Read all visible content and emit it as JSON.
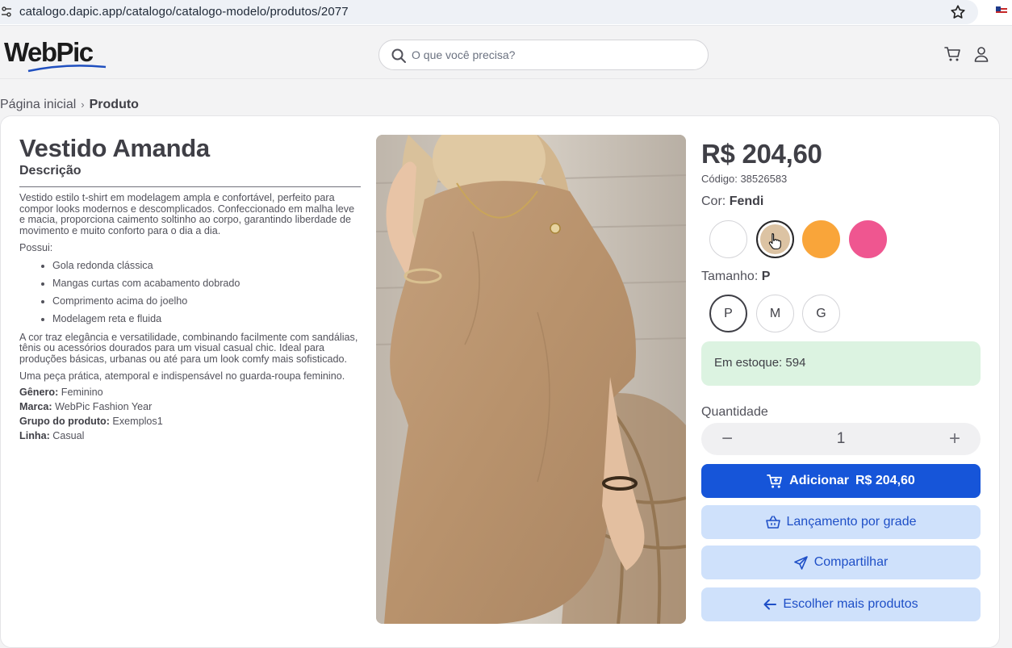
{
  "browser": {
    "url": "catalogo.dapic.app/catalogo/catalogo-modelo/produtos/2077"
  },
  "header": {
    "logo_text": "WebPic",
    "search_placeholder": "O que você precisa?",
    "icons": [
      "search-icon",
      "cart-icon",
      "user-icon"
    ]
  },
  "breadcrumb": {
    "home": "Página inicial",
    "separator": "›",
    "current": "Produto"
  },
  "product": {
    "title": "Vestido Amanda",
    "description_heading": "Descrição",
    "intro": "Vestido estilo t-shirt em modelagem ampla e confortável, perfeito para compor looks modernos e descomplicados. Confeccionado em malha leve e macia, proporciona caimento soltinho ao corpo, garantindo liberdade de movimento e muito conforto para o dia a dia.",
    "features_heading": "Possui:",
    "features": [
      "Gola redonda clássica",
      "Mangas curtas com acabamento dobrado",
      "Comprimento acima do joelho",
      "Modelagem reta e fluida"
    ],
    "styling": "A cor  traz elegância e versatilidade, combinando facilmente com sandálias, tênis ou acessórios dourados para um visual casual chic. Ideal para produções básicas, urbanas ou até para um look comfy mais sofisticado.",
    "closing": "Uma peça prática, atemporal e indispensável no guarda-roupa feminino.",
    "attributes": [
      {
        "label": "Gênero:",
        "value": "Feminino"
      },
      {
        "label": "Marca:",
        "value": "WebPic Fashion Year"
      },
      {
        "label": "Grupo do produto:",
        "value": "Exemplos1"
      },
      {
        "label": "Linha:",
        "value": "Casual"
      }
    ]
  },
  "purchase": {
    "price": "R$ 204,60",
    "code_label": "Código:",
    "code_value": "38526583",
    "color_label": "Cor:",
    "color_selected": "Fendi",
    "colors": [
      "#ffffff",
      "#dcc3a3",
      "#f9a53a",
      "#ef5690"
    ],
    "size_label": "Tamanho:",
    "size_selected": "P",
    "sizes": [
      "P",
      "M",
      "G"
    ],
    "stock_text": "Em estoque: 594",
    "quantity_label": "Quantidade",
    "quantity_value": "1",
    "qty_minus": "−",
    "qty_plus": "+",
    "add_label": "Adicionar",
    "add_price": "R$ 204,60",
    "grid_label": "Lançamento por grade",
    "share_label": "Compartilhar",
    "more_label": "Escolher mais produtos"
  },
  "theme": {
    "primary": "#1655d9",
    "secondary_bg": "#cfe1fb",
    "stock_bg": "#dcf3e1"
  }
}
